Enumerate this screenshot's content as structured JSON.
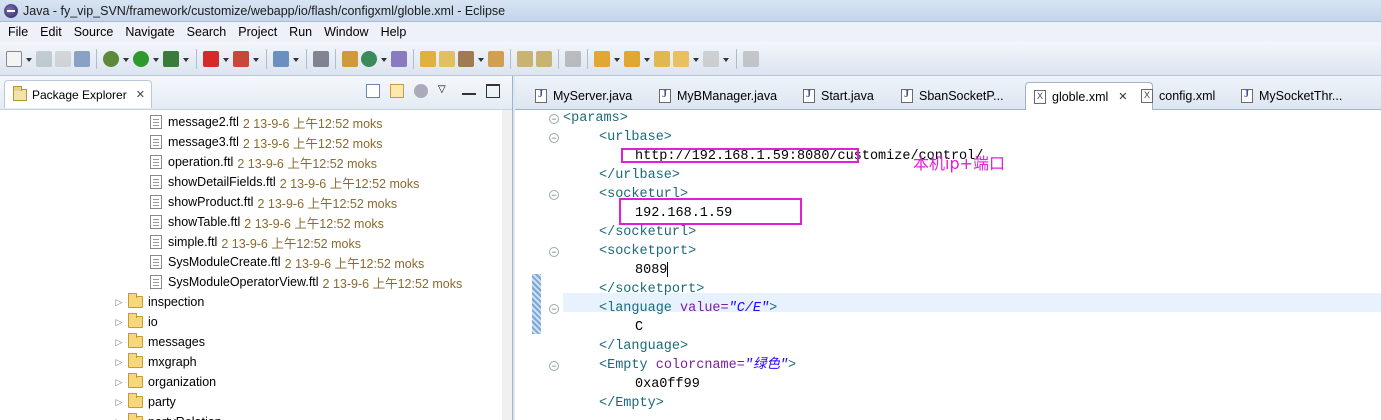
{
  "window": {
    "title": "Java - fy_vip_SVN/framework/customize/webapp/io/flash/configxml/globle.xml - Eclipse"
  },
  "menu": [
    {
      "label": "File",
      "key": "F"
    },
    {
      "label": "Edit",
      "key": "E"
    },
    {
      "label": "Source",
      "key": "S"
    },
    {
      "label": "Navigate",
      "key": "N"
    },
    {
      "label": "Search",
      "key": "a"
    },
    {
      "label": "Project",
      "key": "P"
    },
    {
      "label": "Run",
      "key": "R"
    },
    {
      "label": "Window",
      "key": "W"
    },
    {
      "label": "Help",
      "key": "H"
    }
  ],
  "package_explorer": {
    "title": "Package Explorer",
    "files": [
      {
        "name": "message2.ftl",
        "meta": "2  13-9-6 上午12:52  moks"
      },
      {
        "name": "message3.ftl",
        "meta": "2  13-9-6 上午12:52  moks"
      },
      {
        "name": "operation.ftl",
        "meta": "2  13-9-6 上午12:52  moks"
      },
      {
        "name": "showDetailFields.ftl",
        "meta": "2  13-9-6 上午12:52  moks"
      },
      {
        "name": "showProduct.ftl",
        "meta": "2  13-9-6 上午12:52  moks"
      },
      {
        "name": "showTable.ftl",
        "meta": "2  13-9-6 上午12:52  moks"
      },
      {
        "name": "simple.ftl",
        "meta": "2  13-9-6 上午12:52  moks"
      },
      {
        "name": "SysModuleCreate.ftl",
        "meta": "2  13-9-6 上午12:52  moks"
      },
      {
        "name": "SysModuleOperatorView.ftl",
        "meta": "2  13-9-6 上午12:52  moks"
      }
    ],
    "folders": [
      "inspection",
      "io",
      "messages",
      "mxgraph",
      "organization",
      "party",
      "partyRelation"
    ]
  },
  "editor_tabs": [
    {
      "label": "MyServer.java",
      "type": "java",
      "active": false
    },
    {
      "label": "MyBManager.java",
      "type": "java",
      "active": false
    },
    {
      "label": "Start.java",
      "type": "java",
      "active": false
    },
    {
      "label": "SbanSocketP...",
      "type": "java",
      "active": false
    },
    {
      "label": "globle.xml",
      "type": "xml",
      "active": true
    },
    {
      "label": "config.xml",
      "type": "xml",
      "active": false
    },
    {
      "label": "MySocketThr...",
      "type": "java",
      "active": false
    }
  ],
  "code": {
    "l1": "<params>",
    "l2": "<urlbase>",
    "l3": "http://192.168.1.59:8080/customize/control/",
    "l4": "</urlbase>",
    "l5": "<socketurl>",
    "l6": "192.168.1.59",
    "l7": "</socketurl>",
    "l8": "<socketport>",
    "l9": "8089",
    "l10": "</socketport>",
    "l11_tag": "<language ",
    "l11_attr": "value=",
    "l11_str": "\"C/E\"",
    "l11_end": ">",
    "l12": "C",
    "l13": "</language>",
    "l14_tag": "<Empty ",
    "l14_attr": "colorcname=",
    "l14_str": "\"绿色\"",
    "l14_end": ">",
    "l15": "0xa0ff99",
    "l16": "</Empty>"
  },
  "annotation": "本机ip+端口"
}
